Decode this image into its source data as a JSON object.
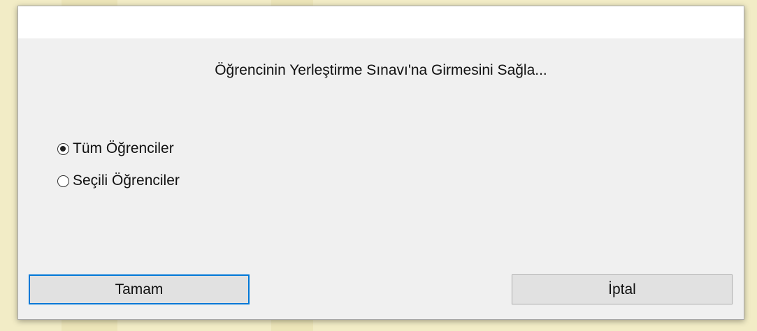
{
  "dialog": {
    "message": "Öğrencinin Yerleştirme Sınavı'na Girmesini Sağla...",
    "options": [
      {
        "label": "Tüm Öğrenciler",
        "selected": true
      },
      {
        "label": "Seçili Öğrenciler",
        "selected": false
      }
    ],
    "ok_label": "Tamam",
    "cancel_label": "İptal"
  },
  "colors": {
    "dialog_bg": "#f0f0f0",
    "title_bar_bg": "#ffffff",
    "button_bg": "#e1e1e1",
    "focus_border": "#0078d7",
    "backdrop": "#f2ecc6"
  }
}
